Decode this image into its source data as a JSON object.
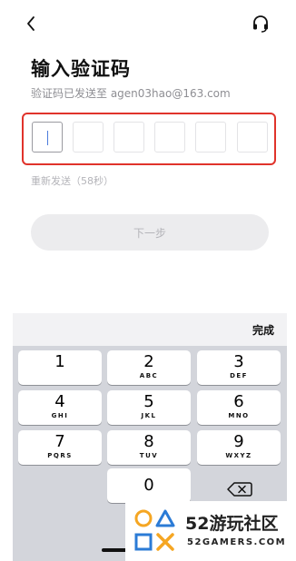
{
  "header": {
    "back_icon": "chevron-left-icon",
    "support_icon": "headset-icon"
  },
  "title": "输入验证码",
  "subtitle": "验证码已发送至 agen03hao@163.com",
  "code": {
    "length": 6,
    "values": [
      "",
      "",
      "",
      "",
      "",
      ""
    ]
  },
  "resend": "重新发送（58秒）",
  "next_button": "下一步",
  "keyboard": {
    "done": "完成",
    "keys": [
      {
        "num": "1",
        "letters": ""
      },
      {
        "num": "2",
        "letters": "ABC"
      },
      {
        "num": "3",
        "letters": "DEF"
      },
      {
        "num": "4",
        "letters": "GHI"
      },
      {
        "num": "5",
        "letters": "JKL"
      },
      {
        "num": "6",
        "letters": "MNO"
      },
      {
        "num": "7",
        "letters": "PQRS"
      },
      {
        "num": "8",
        "letters": "TUV"
      },
      {
        "num": "9",
        "letters": "WXYZ"
      },
      {
        "num": "0",
        "letters": ""
      }
    ],
    "delete_icon": "backspace-icon"
  },
  "watermark": {
    "brand": "52游玩社区",
    "domain": "52GAMERS.COM"
  },
  "colors": {
    "highlight": "#e0332b",
    "caret": "#4b7bdc",
    "keyboard_bg": "#d3d5db"
  }
}
